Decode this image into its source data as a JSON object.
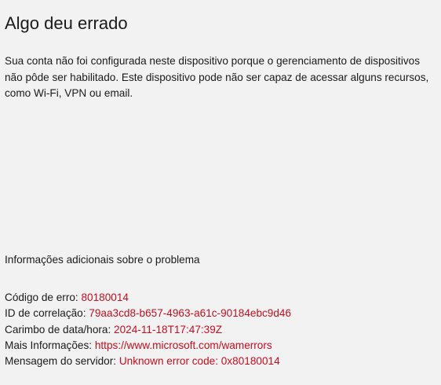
{
  "error_page": {
    "title": "Algo deu errado",
    "message": "Sua conta não foi configurada neste dispositivo porque o gerenciamento de dispositivos não pôde ser habilitado. Este dispositivo pode não ser capaz de acessar alguns recursos, como Wi-Fi, VPN ou email.",
    "additional_info_heading": "Informações adicionais sobre o problema",
    "details": [
      {
        "label": "Código de erro:",
        "value": "80180014"
      },
      {
        "label": "ID de correlação:",
        "value": "79aa3cd8-b657-4963-a61c-90184ebc9d46"
      },
      {
        "label": "Carimbo de data/hora:",
        "value": "2024-11-18T17:47:39Z"
      },
      {
        "label": "Mais Informações:",
        "value": "https://www.microsoft.com/wamerrors"
      },
      {
        "label": "Mensagem do servidor:",
        "value": "Unknown error code: 0x80180014"
      }
    ]
  },
  "colors": {
    "background": "#f2f2f2",
    "text": "#1a1a1a",
    "value_red": "#c50f1f"
  }
}
